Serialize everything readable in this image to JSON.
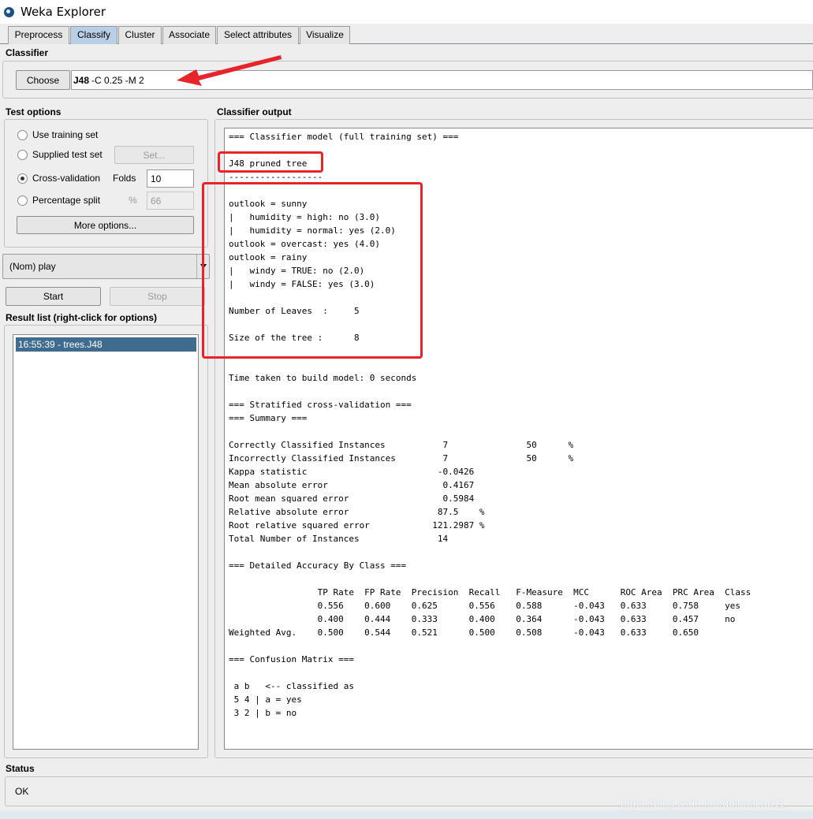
{
  "window": {
    "title": "Weka Explorer"
  },
  "tabs": [
    {
      "label": "Preprocess"
    },
    {
      "label": "Classify"
    },
    {
      "label": "Cluster"
    },
    {
      "label": "Associate"
    },
    {
      "label": "Select attributes"
    },
    {
      "label": "Visualize"
    }
  ],
  "classifier": {
    "section_title": "Classifier",
    "choose_label": "Choose",
    "name": "J48",
    "options": "-C 0.25 -M 2"
  },
  "test_options": {
    "section_title": "Test options",
    "use_training_set": "Use training set",
    "supplied_test_set": "Supplied test set",
    "set_button": "Set...",
    "cross_validation": "Cross-validation",
    "folds_label": "Folds",
    "folds_value": "10",
    "percentage_split": "Percentage split",
    "percent_symbol": "%",
    "percent_value": "66",
    "more_options": "More options...",
    "selected": "cross_validation"
  },
  "class_attribute": {
    "value": "(Nom) play"
  },
  "run": {
    "start_label": "Start",
    "stop_label": "Stop"
  },
  "result_list": {
    "section_title": "Result list (right-click for options)",
    "items": [
      "16:55:39 - trees.J48"
    ]
  },
  "output": {
    "section_title": "Classifier output",
    "lines": [
      "=== Classifier model (full training set) ===",
      "",
      "J48 pruned tree",
      "------------------",
      "",
      "outlook = sunny",
      "|   humidity = high: no (3.0)",
      "|   humidity = normal: yes (2.0)",
      "outlook = overcast: yes (4.0)",
      "outlook = rainy",
      "|   windy = TRUE: no (2.0)",
      "|   windy = FALSE: yes (3.0)",
      "",
      "Number of Leaves  :     5",
      "",
      "Size of the tree :      8",
      "",
      "",
      "Time taken to build model: 0 seconds",
      "",
      "=== Stratified cross-validation ===",
      "=== Summary ===",
      "",
      "Correctly Classified Instances           7               50      %",
      "Incorrectly Classified Instances         7               50      %",
      "Kappa statistic                         -0.0426",
      "Mean absolute error                      0.4167",
      "Root mean squared error                  0.5984",
      "Relative absolute error                 87.5    %",
      "Root relative squared error            121.2987 %",
      "Total Number of Instances               14",
      "",
      "=== Detailed Accuracy By Class ===",
      "",
      "                 TP Rate  FP Rate  Precision  Recall   F-Measure  MCC      ROC Area  PRC Area  Class",
      "                 0.556    0.600    0.625      0.556    0.588      -0.043   0.633     0.758     yes",
      "                 0.400    0.444    0.333      0.400    0.364      -0.043   0.633     0.457     no",
      "Weighted Avg.    0.500    0.544    0.521      0.500    0.508      -0.043   0.633     0.650",
      "",
      "=== Confusion Matrix ===",
      "",
      " a b   <-- classified as",
      " 5 4 | a = yes",
      " 3 2 | b = no"
    ]
  },
  "status": {
    "section_title": "Status",
    "text": "OK"
  },
  "watermark": "https://blog.csdn.net/dujuancao11",
  "colors": {
    "annotation_red": "#e8232a",
    "selected_tab": "#b8cfe5",
    "selected_row": "#3f6b8f"
  }
}
